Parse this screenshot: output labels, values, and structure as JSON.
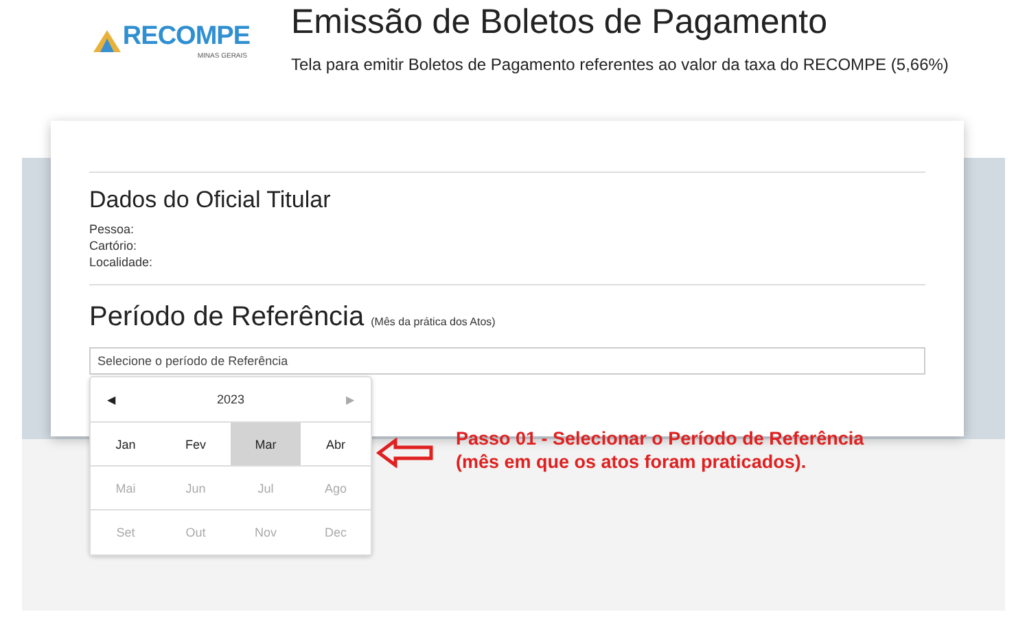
{
  "logo": {
    "name": "RECOMPE",
    "tagline": "MINAS GERAIS"
  },
  "header": {
    "title": "Emissão de Boletos de Pagamento",
    "subtitle": "Tela para emitir Boletos de Pagamento referentes ao valor da taxa do RECOMPE (5,66%)"
  },
  "oficial": {
    "heading": "Dados do Oficial Titular",
    "fields": [
      "Pessoa:",
      "Cartório:",
      "Localidade:"
    ]
  },
  "periodo": {
    "heading": "Período de Referência",
    "note": "(Mês da prática dos Atos)",
    "placeholder": "Selecione o período de Referência"
  },
  "calendar": {
    "prev": "◀",
    "year": "2023",
    "next": "▶",
    "months": [
      {
        "label": "Jan",
        "disabled": false,
        "selected": false
      },
      {
        "label": "Fev",
        "disabled": false,
        "selected": false
      },
      {
        "label": "Mar",
        "disabled": false,
        "selected": true
      },
      {
        "label": "Abr",
        "disabled": false,
        "selected": false
      },
      {
        "label": "Mai",
        "disabled": true,
        "selected": false
      },
      {
        "label": "Jun",
        "disabled": true,
        "selected": false
      },
      {
        "label": "Jul",
        "disabled": true,
        "selected": false
      },
      {
        "label": "Ago",
        "disabled": true,
        "selected": false
      },
      {
        "label": "Set",
        "disabled": true,
        "selected": false
      },
      {
        "label": "Out",
        "disabled": true,
        "selected": false
      },
      {
        "label": "Nov",
        "disabled": true,
        "selected": false
      },
      {
        "label": "Dec",
        "disabled": true,
        "selected": false
      }
    ]
  },
  "annotation": {
    "text": "Passo 01 - Selecionar o Período de Referência (mês em que os atos foram praticados)."
  }
}
